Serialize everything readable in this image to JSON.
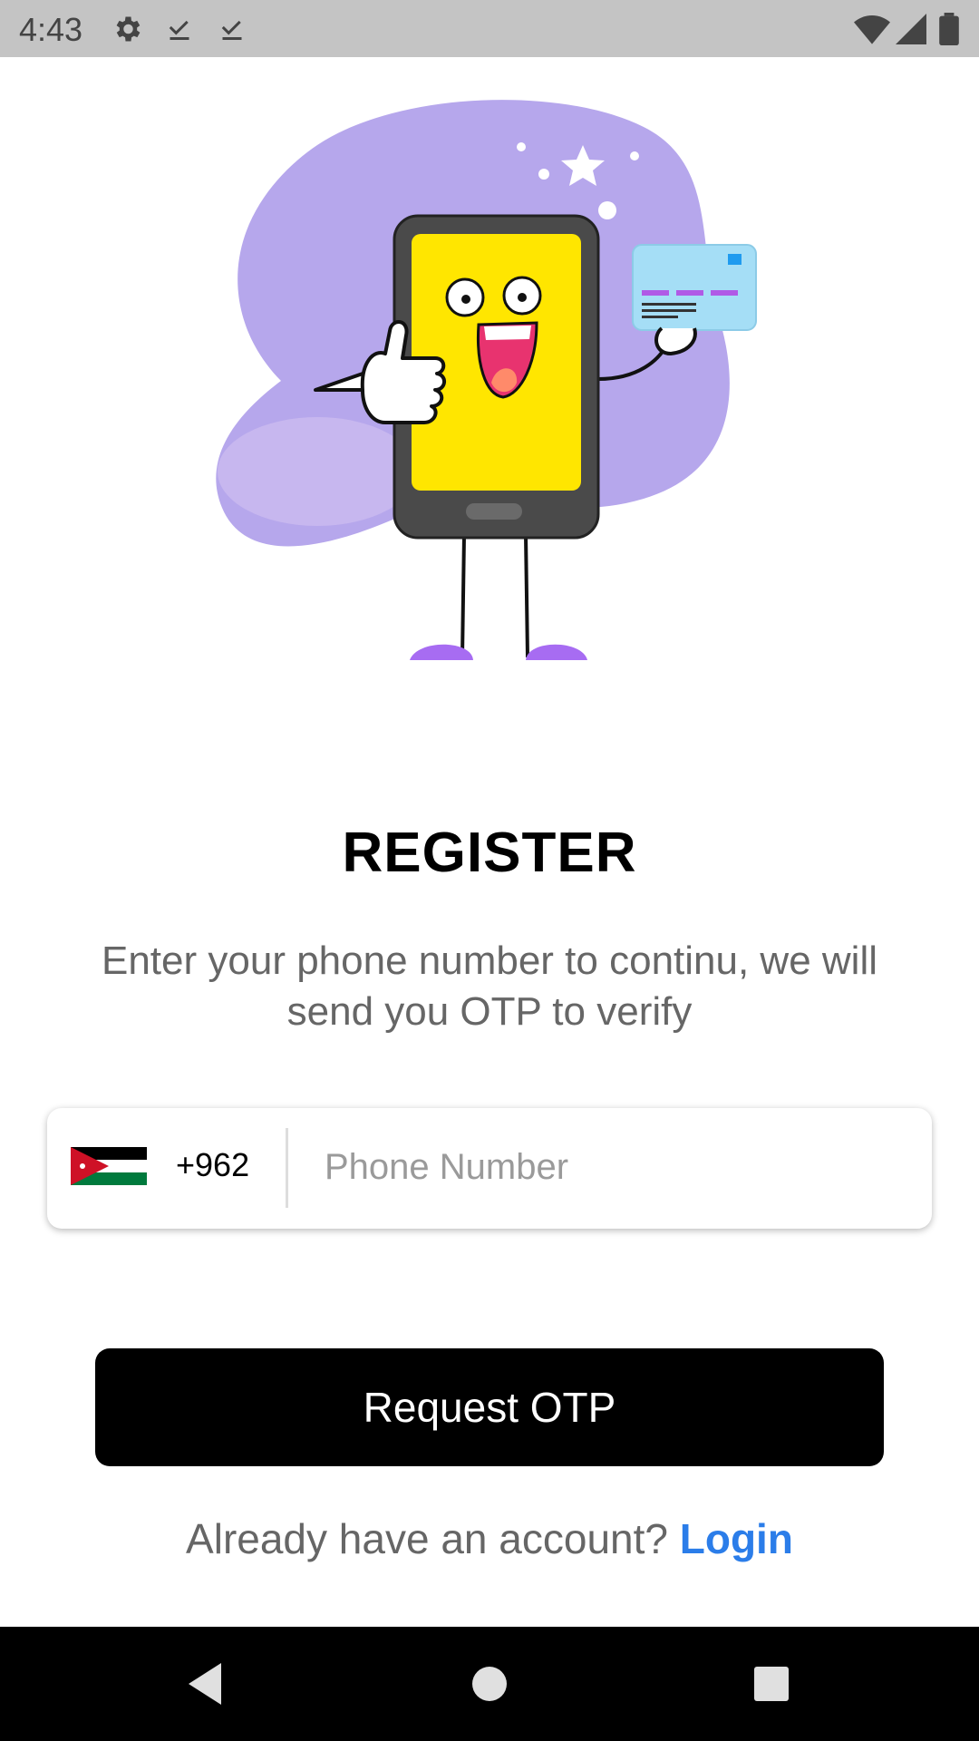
{
  "status_bar": {
    "time": "4:43",
    "icons": [
      "gear-icon",
      "download-done-icon",
      "download-done-icon",
      "wifi-icon",
      "signal-icon",
      "battery-icon"
    ]
  },
  "main": {
    "title": "REGISTER",
    "subtitle": "Enter your phone number to continu, we will send you OTP to verify"
  },
  "phone_field": {
    "country_code": "+962",
    "placeholder": "Phone Number",
    "value": ""
  },
  "actions": {
    "request_label": "Request OTP",
    "login_prompt": "Already have an account?",
    "login_label": "Login"
  },
  "colors": {
    "accent": "#2b7de9",
    "button": "#000000",
    "muted_text": "#666666",
    "hero_blob": "#b3a3ea",
    "phone_screen": "#ffe600"
  },
  "nav_bar": {
    "icons": [
      "back-icon",
      "home-icon",
      "recents-icon"
    ]
  }
}
